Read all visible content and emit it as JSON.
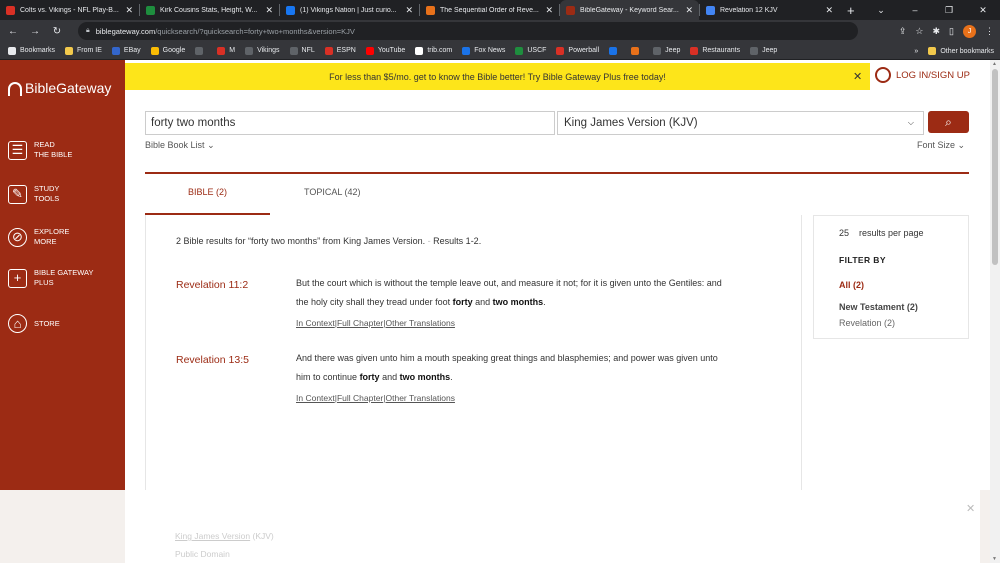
{
  "browser": {
    "tabs": [
      {
        "title": "Colts vs. Vikings - NFL Play-B...",
        "color": "#d93025"
      },
      {
        "title": "Kirk Cousins Stats, Height, W...",
        "color": "#1e8e3e"
      },
      {
        "title": "(1) Vikings Nation | Just curio...",
        "color": "#1877f2"
      },
      {
        "title": "The Sequential Order of Reve...",
        "color": "#e8711a"
      },
      {
        "title": "BibleGateway - Keyword Sear...",
        "color": "#9c2b14"
      },
      {
        "title": "Revelation 12 KJV",
        "color": "#4285f4"
      }
    ],
    "new_tab": "+",
    "window_controls": {
      "dropdown": "⌄",
      "minimize": "–",
      "restore": "❐",
      "close": "✕"
    },
    "url_domain": "biblegateway.com",
    "url_path": "/quicksearch/?quicksearch=forty+two+months&version=KJV",
    "profile_initial": "J",
    "bookmarks": [
      {
        "label": "Bookmarks",
        "color": "#e8eaed"
      },
      {
        "label": "From IE",
        "color": "#f2c94c"
      },
      {
        "label": "EBay",
        "color": "#3366cc"
      },
      {
        "label": "Google",
        "color": "#fbbc04"
      },
      {
        "label": "",
        "color": "#5f6368"
      },
      {
        "label": "M",
        "color": "#d93025"
      },
      {
        "label": "Vikings",
        "color": "#5f6368"
      },
      {
        "label": "NFL",
        "color": "#5f6368"
      },
      {
        "label": "ESPN",
        "color": "#d93025"
      },
      {
        "label": "YouTube",
        "color": "#ff0000"
      },
      {
        "label": "trib.com",
        "color": "#ffffff"
      },
      {
        "label": "Fox News",
        "color": "#1a73e8"
      },
      {
        "label": "USCF",
        "color": "#1e8e3e"
      },
      {
        "label": "Powerball",
        "color": "#d93025"
      },
      {
        "label": "",
        "color": "#1a73e8"
      },
      {
        "label": "",
        "color": "#e8711a"
      },
      {
        "label": "Jeep",
        "color": "#5f6368"
      },
      {
        "label": "Restaurants",
        "color": "#d93025"
      },
      {
        "label": "Jeep",
        "color": "#5f6368"
      }
    ],
    "other_bookmarks": "Other bookmarks",
    "bookmarks_overflow": "»"
  },
  "site": {
    "logo": "BibleGateway",
    "promo": "For less than $5/mo. get to know the Bible better! Try Bible Gateway Plus free today!",
    "promo_close": "✕",
    "login": "LOG IN/SIGN UP",
    "nav": [
      {
        "line1": "READ",
        "line2": "THE BIBLE",
        "icon": "book-icon",
        "glyph": "☰"
      },
      {
        "line1": "STUDY",
        "line2": "TOOLS",
        "icon": "study-icon",
        "glyph": "✎"
      },
      {
        "line1": "EXPLORE",
        "line2": "MORE",
        "icon": "compass-icon",
        "glyph": "⊘"
      },
      {
        "line1": "BIBLE GATEWAY",
        "line2": "PLUS",
        "icon": "plus-icon",
        "glyph": "+"
      },
      {
        "line1": "STORE",
        "line2": "",
        "icon": "store-icon",
        "glyph": "⌂"
      }
    ]
  },
  "search": {
    "query": "forty two months",
    "version": "King James Version (KJV)",
    "button_icon": "search-icon",
    "button_glyph": "⌕",
    "book_list": "Bible Book List",
    "font_size": "Font Size"
  },
  "tabs": {
    "bible": "BIBLE (2)",
    "topical": "TOPICAL (42)"
  },
  "results": {
    "summary_prefix": "2 Bible results for",
    "summary_query": "“forty two months”",
    "summary_suffix": "from King James Version.",
    "summary_sep": "-",
    "summary_range": "Results 1-2.",
    "items": [
      {
        "ref": "Revelation 11:2",
        "line1": "But the court which is without the temple leave out, and measure it not; for it is given unto the Gentiles: and",
        "line2_pre": "the holy city shall they tread under foot",
        "kw1": "forty",
        "mid": "and",
        "kw2": "two months",
        "end": ".",
        "links": [
          "In Context",
          "Full Chapter",
          "Other Translations"
        ]
      },
      {
        "ref": "Revelation 13:5",
        "line1": "And there was given unto him a mouth speaking great things and blasphemies; and power was given unto",
        "line2_pre": "him to continue",
        "kw1": "forty",
        "mid": "and",
        "kw2": "two months",
        "end": ".",
        "links": [
          "In Context",
          "Full Chapter",
          "Other Translations"
        ]
      }
    ],
    "link_sep": "|"
  },
  "filter": {
    "per_page_value": "25",
    "per_page_label": "results per page",
    "heading": "FILTER BY",
    "all": "All (2)",
    "new_testament": "New Testament (2)",
    "revelation": "Revelation (2)"
  },
  "footer": {
    "version_link": "King James Version",
    "version_abbr": "(KJV)",
    "license": "Public Domain",
    "close": "✕"
  }
}
